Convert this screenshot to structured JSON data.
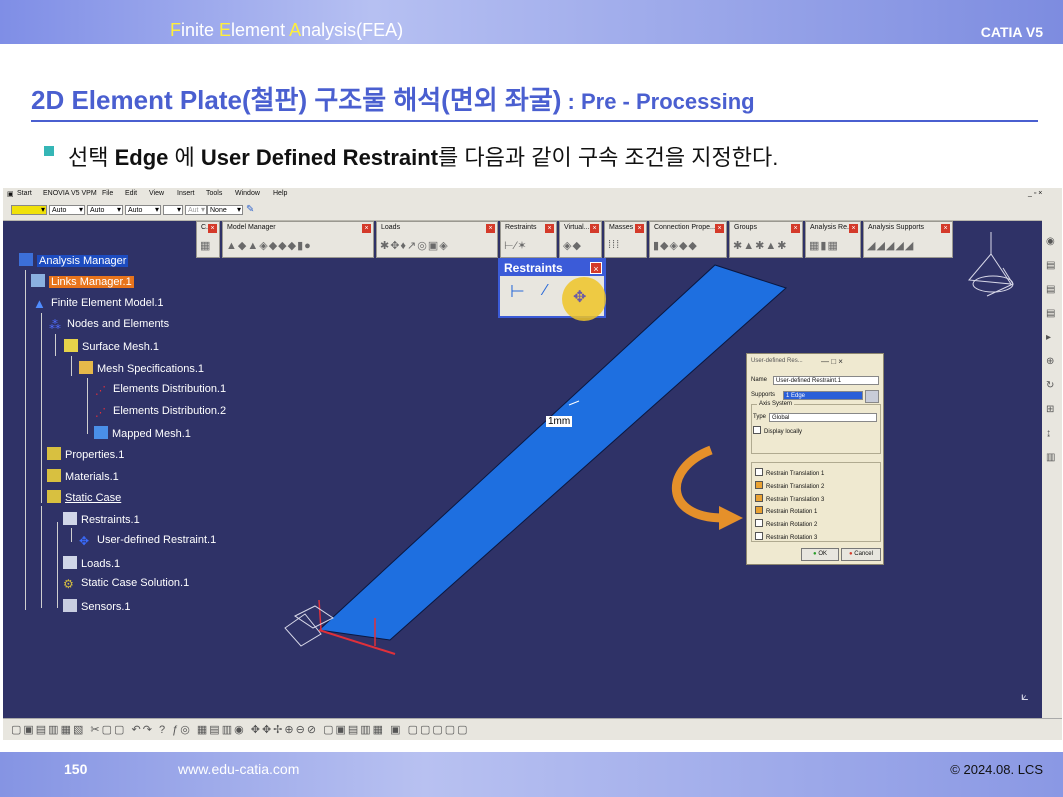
{
  "header": {
    "title_parts": [
      "F",
      "inite ",
      "E",
      "lement ",
      "A",
      "nalysis(FEA)"
    ],
    "brand": "CATIA V5"
  },
  "slide": {
    "title": "2D Element Plate(철판) 구조물 해석(면외 좌굴)",
    "title_sub": " : Pre - Processing",
    "bullet": {
      "t1": "선택 ",
      "b1": "Edge",
      "t2": " 에 ",
      "b2": "User Defined Restraint",
      "t3": "를 다음과 같이 구속 조건을 지정한다."
    }
  },
  "catia": {
    "menu": [
      "Start",
      "ENOVIA V5 VPM",
      "File",
      "Edit",
      "View",
      "Insert",
      "Tools",
      "Window",
      "Help"
    ],
    "window_controls": "_ ▫ ×",
    "toolbar_combos": [
      "Auto",
      "Auto",
      "Auto",
      "Aut",
      "None"
    ],
    "toolbar_groups": [
      {
        "label": "C..."
      },
      {
        "label": "Model Manager"
      },
      {
        "label": "Loads"
      },
      {
        "label": "Restraints"
      },
      {
        "label": "Virtual..."
      },
      {
        "label": "Masses"
      },
      {
        "label": "Connection Prope..."
      },
      {
        "label": "Groups"
      },
      {
        "label": "Analysis Re..."
      },
      {
        "label": "Analysis Supports"
      }
    ],
    "tree": [
      "Analysis Manager",
      "Links Manager.1",
      "Finite Element Model.1",
      "Nodes and Elements",
      "Surface Mesh.1",
      "Mesh Specifications.1",
      "Elements Distribution.1",
      "Elements Distribution.2",
      "Mapped Mesh.1",
      "Properties.1",
      "Materials.1",
      "Static Case",
      "Restraints.1",
      "User-defined Restraint.1",
      "Loads.1",
      "Static Case Solution.1",
      "Sensors.1"
    ],
    "restraints_popup": {
      "title": "Restraints"
    },
    "dimension_label": "1mm",
    "dialog": {
      "title": "User-defined Res...",
      "title_controls": "— □ ×",
      "name_label": "Name",
      "name_value": "User-defined Restraint.1",
      "supports_label": "Supports",
      "supports_value": "1 Edge",
      "axis_system": "Axis System",
      "type_label": "Type",
      "type_value": "Global",
      "display_locally": "Display locally",
      "options": [
        {
          "label": "Restrain Translation 1",
          "checked": false
        },
        {
          "label": "Restrain Translation 2",
          "checked": true
        },
        {
          "label": "Restrain Translation 3",
          "checked": true
        },
        {
          "label": "Restrain Rotation 1",
          "checked": true
        },
        {
          "label": "Restrain Rotation 2",
          "checked": false
        },
        {
          "label": "Restrain Rotation 3",
          "checked": false
        }
      ],
      "ok": "OK",
      "cancel": "Cancel"
    }
  },
  "footer": {
    "page": "150",
    "url": "www.edu-catia.com",
    "copyright": "© 2024.08. LCS"
  },
  "colors": {
    "background_3d": "#2f3267",
    "plate": "#1e6fe0",
    "title_blue": "#4a5fd0",
    "highlight": "#eec428",
    "arrow": "#e5902a"
  }
}
